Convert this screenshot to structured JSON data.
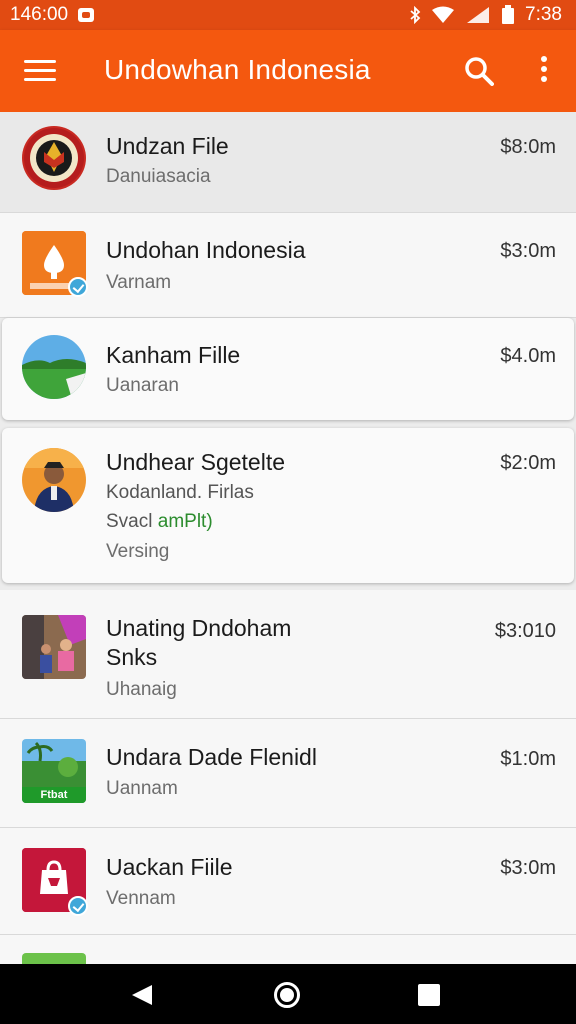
{
  "status_bar": {
    "time": "146:00",
    "clock_right": "7:38"
  },
  "app_bar": {
    "title": "Undowhan Indonesia"
  },
  "items": [
    {
      "title": "Undzan File",
      "subtitle": "Danuiasacia",
      "price": "$8:0m",
      "thumb": "emblem-icon"
    },
    {
      "title": "Undohan Indonesia",
      "subtitle": "Varnam",
      "price": "$3:0m",
      "thumb": "app-logo-icon"
    },
    {
      "title": "Kanham Fille",
      "subtitle": "Uanaran",
      "price": "$4.0m",
      "thumb": "landscape-icon"
    },
    {
      "title": "Undhear Sgetelte",
      "subtitle": "Kodanland. Firlas",
      "subtitle2_a": "Svacl ",
      "subtitle2_b": "amPlt)",
      "subtitle3": "Versing",
      "price": "$2:0m",
      "thumb": "person-photo-icon"
    },
    {
      "title": "Unating Dndoham",
      "title2": "Snks",
      "subtitle": "Uhanaig",
      "price": "$3:010",
      "thumb": "street-photo-icon"
    },
    {
      "title": "Undara Dade Flenidl",
      "subtitle": "Uannam",
      "price": "$1:0m",
      "thumb": "palm-photo-icon",
      "thumb_label": "Ftbat"
    },
    {
      "title": "Uackan Fiile",
      "subtitle": "Vennam",
      "price": "$3:0m",
      "thumb": "bag-icon"
    }
  ],
  "colors": {
    "status": "#e14b12",
    "appbar": "#f4580f",
    "verify": "#3fa7d9",
    "green_text": "#2c8c2e"
  }
}
